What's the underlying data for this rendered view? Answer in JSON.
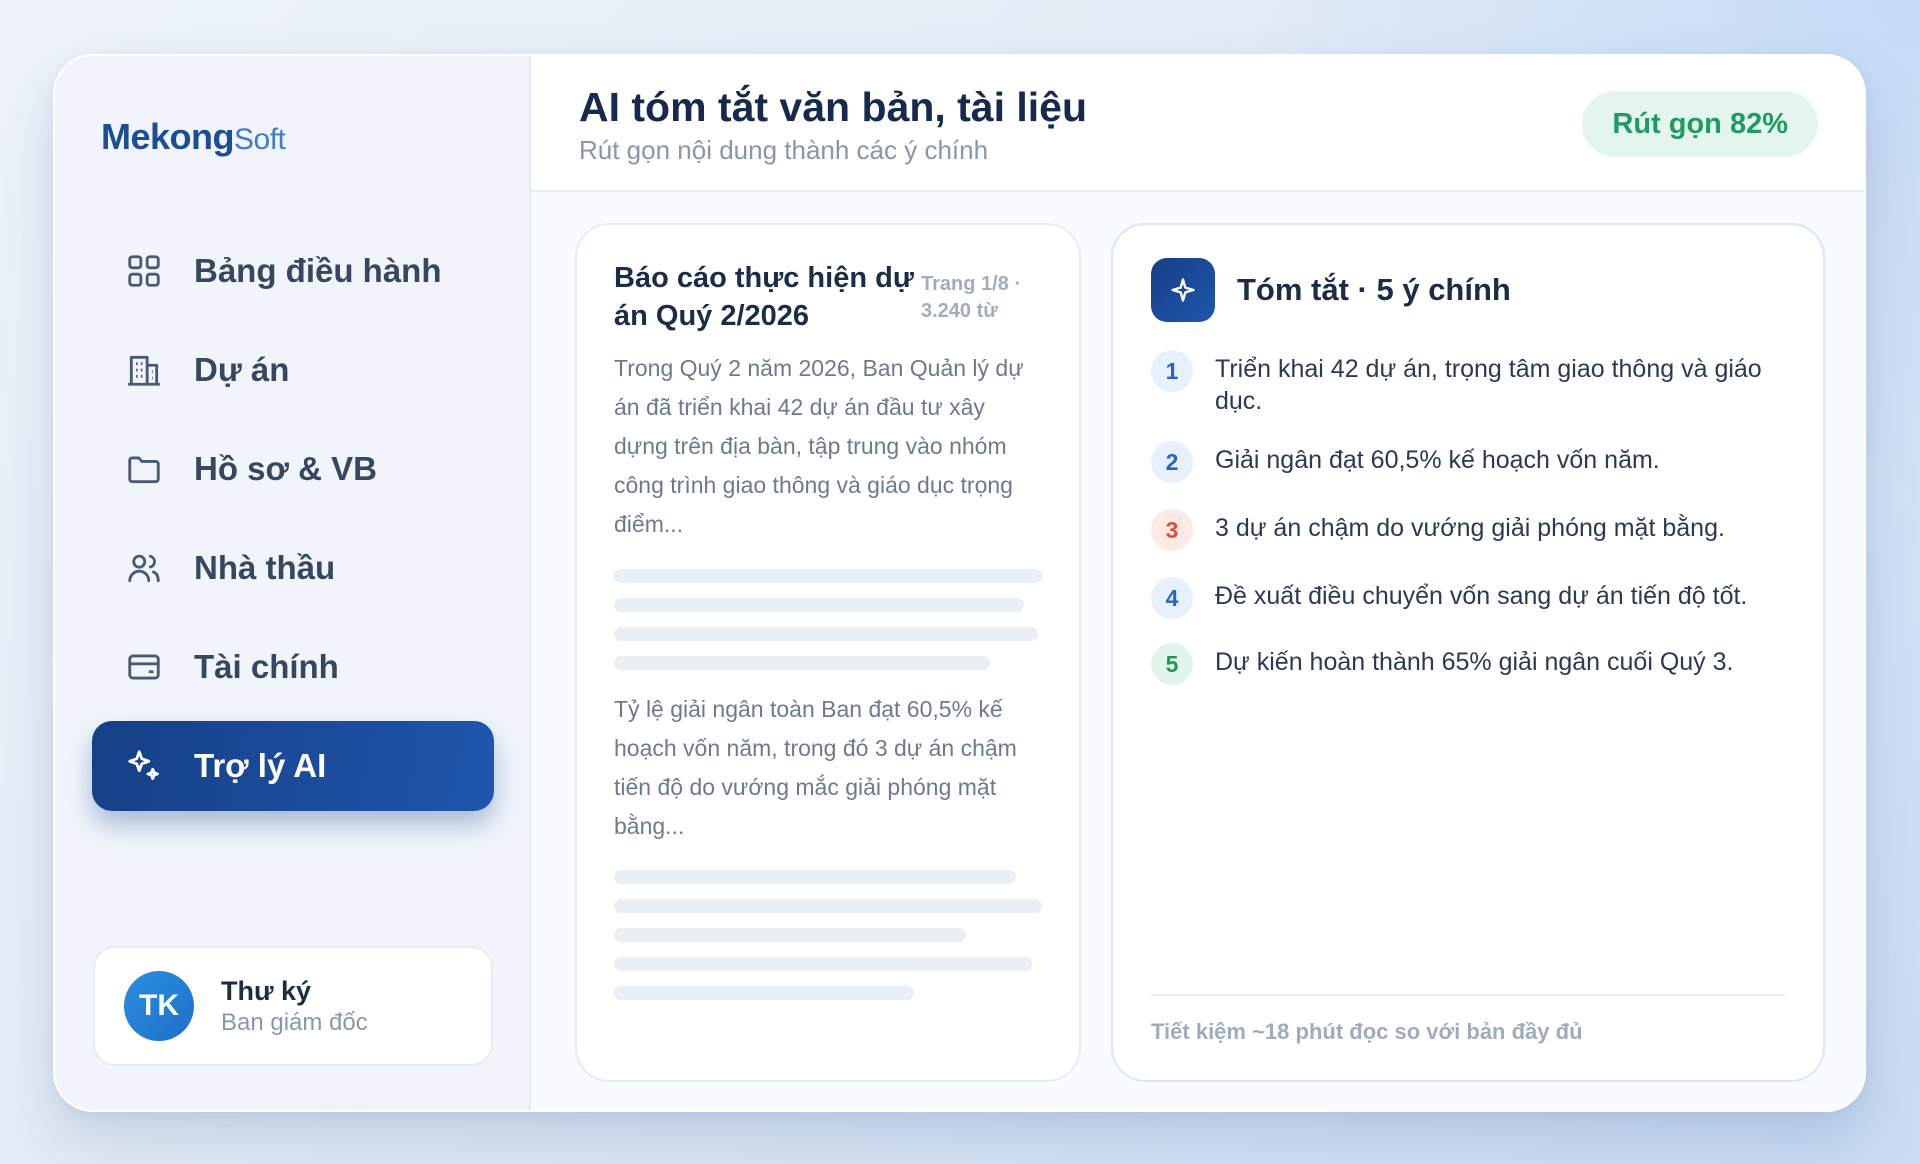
{
  "brand": {
    "name_main": "Mekong",
    "name_suffix": "Soft"
  },
  "sidebar": {
    "items": [
      {
        "label": "Bảng điều hành",
        "icon": "dashboard-grid-icon"
      },
      {
        "label": "Dự án",
        "icon": "building-icon"
      },
      {
        "label": "Hồ sơ & VB",
        "icon": "folder-icon"
      },
      {
        "label": "Nhà thầu",
        "icon": "users-icon"
      },
      {
        "label": "Tài chính",
        "icon": "wallet-card-icon"
      },
      {
        "label": "Trợ lý AI",
        "icon": "sparkle-icon",
        "active": true
      }
    ]
  },
  "user": {
    "initials": "TK",
    "name": "Thư ký",
    "role": "Ban giám đốc"
  },
  "header": {
    "title": "AI tóm tắt văn bản, tài liệu",
    "subtitle": "Rút gọn nội dung thành các ý chính",
    "badge": "Rút gọn 82%"
  },
  "document": {
    "title": "Báo cáo thực hiện dự án Quý 2/2026",
    "meta": "Trang 1/8 · 3.240 từ",
    "paragraph1": "Trong Quý 2 năm 2026, Ban Quản lý dự án đã triển khai 42 dự án đầu tư xây dựng trên địa bàn, tập trung vào nhóm công trình giao thông và giáo dục trọng điểm...",
    "paragraph2": "Tỷ lệ giải ngân toàn Ban đạt 60,5% kế hoạch vốn năm, trong đó 3 dự án chậm tiến độ do vướng mắc giải phóng mặt bằng..."
  },
  "summary": {
    "title": "Tóm tắt · 5 ý chính",
    "icon": "sparkle-icon",
    "points": [
      {
        "num": "1",
        "text": "Triển khai 42 dự án, trọng tâm giao thông và giáo dục.",
        "color": "#2267c1"
      },
      {
        "num": "2",
        "text": "Giải ngân đạt 60,5% kế hoạch vốn năm.",
        "color": "#2267c1"
      },
      {
        "num": "3",
        "text": "3 dự án chậm do vướng giải phóng mặt bằng.",
        "color": "#d9503a"
      },
      {
        "num": "4",
        "text": "Đề xuất điều chuyển vốn sang dự án tiến độ tốt.",
        "color": "#2267c1"
      },
      {
        "num": "5",
        "text": "Dự kiến hoàn thành 65% giải ngân cuối Quý 3.",
        "color": "#22985b"
      }
    ],
    "footer": "Tiết kiệm ~18 phút đọc so với bản đầy đủ"
  },
  "colors": {
    "accent": "#1f56ad",
    "success": "#1f9a62",
    "danger": "#d9503a"
  }
}
